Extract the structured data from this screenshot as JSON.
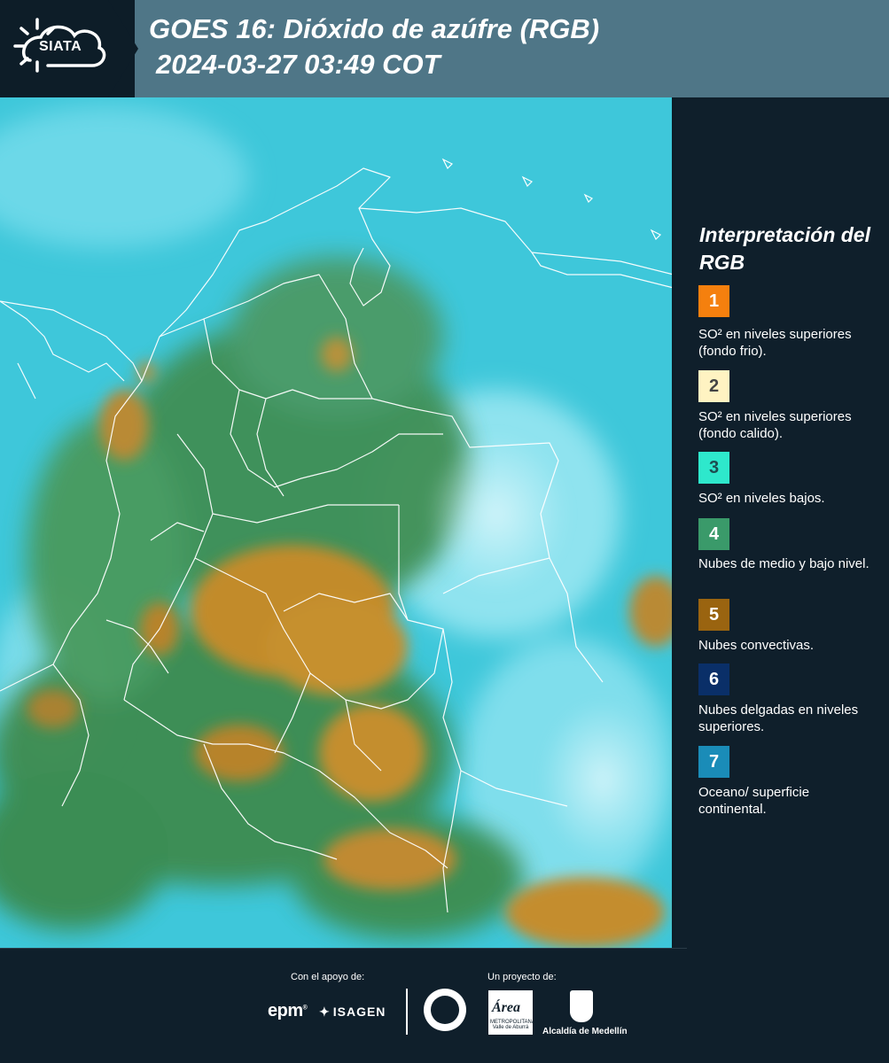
{
  "header": {
    "logo_text": "SIATA",
    "title": "GOES 16: Dióxido de azúfre (RGB)",
    "subtitle": "2024-03-27 03:49 COT"
  },
  "legend": {
    "title": "Interpretación del RGB",
    "items": [
      {
        "number": "1",
        "color": "#f5800e",
        "text_color": "#ffffff",
        "label": "SO² en niveles superiores (fondo frio)."
      },
      {
        "number": "2",
        "color": "#fff3c2",
        "text_color": "#444444",
        "label": "SO² en niveles superiores (fondo calido)."
      },
      {
        "number": "3",
        "color": "#2ee8cc",
        "text_color": "#1d4d50",
        "label": "SO² en niveles bajos."
      },
      {
        "number": "4",
        "color": "#3a9a6a",
        "text_color": "#ffffff",
        "label": "Nubes de medio y bajo nivel."
      },
      {
        "number": "5",
        "color": "#9a6410",
        "text_color": "#ffffff",
        "label": "Nubes convectivas."
      },
      {
        "number": "6",
        "color": "#0a2f68",
        "text_color": "#ffffff",
        "label": "Nubes delgadas en niveles superiores."
      },
      {
        "number": "7",
        "color": "#1a8cb8",
        "text_color": "#ffffff",
        "label": "Oceano/ superficie continental."
      }
    ]
  },
  "footer": {
    "support_label": "Con el apoyo de:",
    "project_label": "Un proyecto de:",
    "sponsor_1": "epm",
    "sponsor_2": "ISAGEN",
    "partner_1": "Área",
    "partner_1_sub": "METROPOLITANA Valle de Aburrá",
    "partner_2": "Alcaldía de Medellín"
  },
  "colors": {
    "header_bg": "#4f7687",
    "panel_bg": "#0f1f2b",
    "ocean_cyan": "#3cc6d8",
    "convective_orange": "#c6902f",
    "cloud_green": "#3f8f55"
  }
}
